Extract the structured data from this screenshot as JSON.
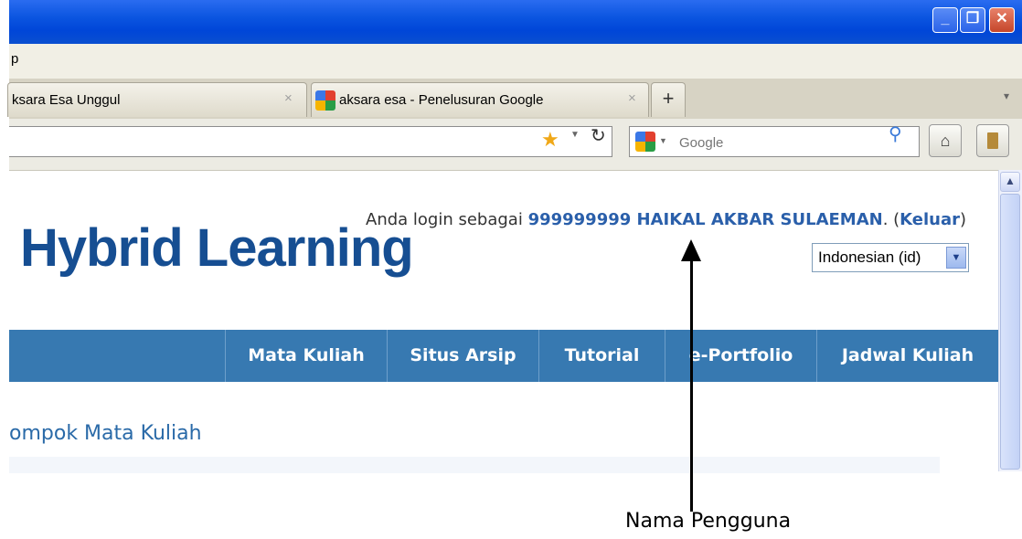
{
  "browser": {
    "menu": {
      "help_label": "p"
    },
    "tabs": [
      {
        "label": "ksara Esa Unggul",
        "close": "×"
      },
      {
        "label": "aksara esa - Penelusuran Google",
        "close": "×"
      }
    ],
    "new_tab_label": "+",
    "tab_list_arrow": "▾",
    "search": {
      "placeholder": "Google"
    },
    "icons": {
      "minimize": "minimize-icon",
      "restore": "restore-icon",
      "close": "close-icon",
      "star": "star-icon",
      "reload": "reload-icon",
      "search": "magnify-icon",
      "home": "home-icon",
      "bookmarks": "bookmark-icon"
    }
  },
  "page": {
    "login": {
      "prefix": "Anda login sebagai ",
      "user": "999999999 HAIKAL AKBAR SULAEMAN",
      "middle": ". (",
      "logout": "Keluar",
      "suffix": ")"
    },
    "site_title": "Hybrid Learning",
    "language": {
      "selected": "Indonesian (id)"
    },
    "nav": [
      {
        "label": "Mata Kuliah"
      },
      {
        "label": "Situs Arsip"
      },
      {
        "label": "Tutorial"
      },
      {
        "label": "e-Portfolio"
      },
      {
        "label": "Jadwal Kuliah"
      }
    ],
    "section_heading": "ompok Mata Kuliah"
  },
  "annotation": {
    "label": "Nama Pengguna"
  },
  "colors": {
    "brand_blue": "#164e92",
    "nav_bar": "#3779b1",
    "link_blue": "#2a5faa",
    "titlebar": "#0b55e0"
  }
}
